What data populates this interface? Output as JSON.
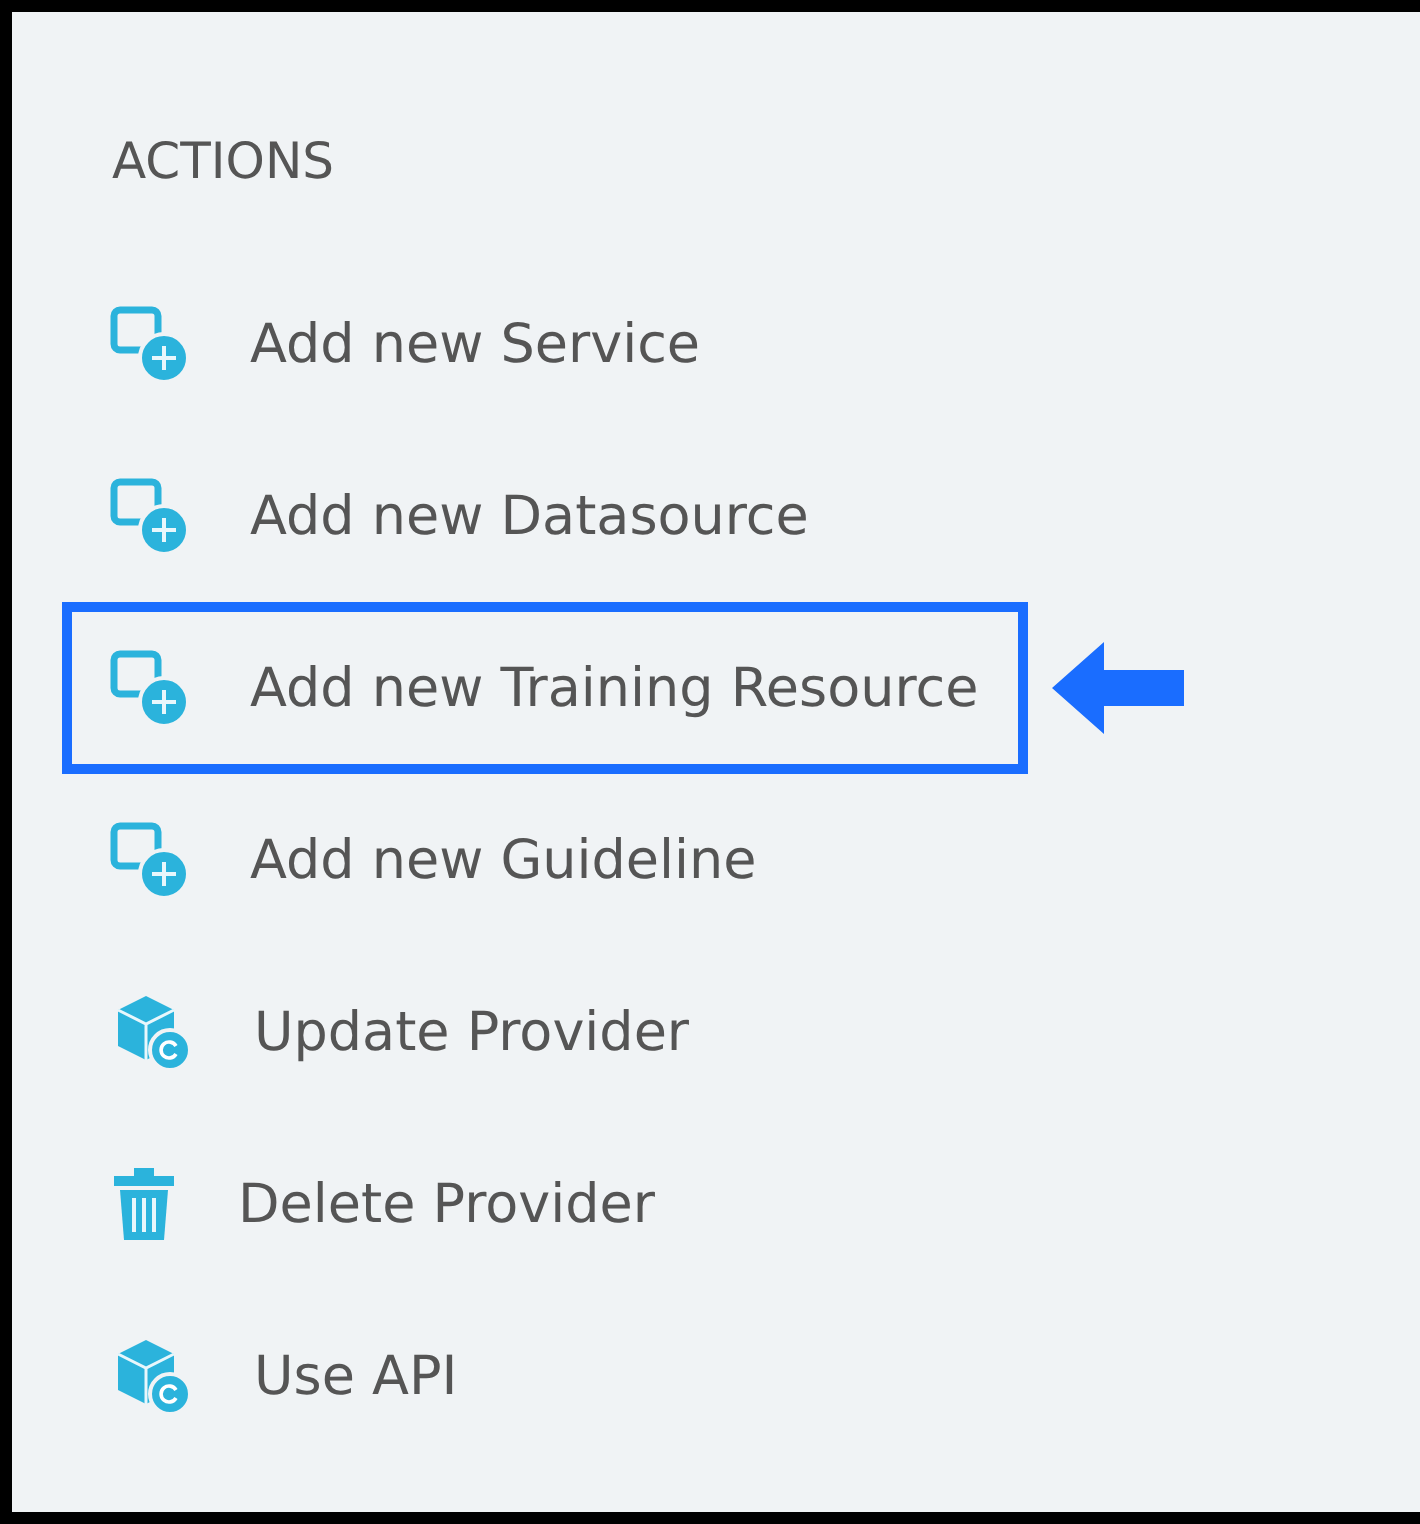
{
  "panel": {
    "heading": "ACTIONS",
    "items": [
      {
        "kind": "add",
        "label": "Add new Service",
        "highlighted": false
      },
      {
        "kind": "add",
        "label": "Add new Datasource",
        "highlighted": false
      },
      {
        "kind": "add",
        "label": "Add new Training Resource",
        "highlighted": true
      },
      {
        "kind": "add",
        "label": "Add new Guideline",
        "highlighted": false
      },
      {
        "kind": "cube",
        "label": "Update Provider",
        "highlighted": false
      },
      {
        "kind": "trash",
        "label": "Delete Provider",
        "highlighted": false
      },
      {
        "kind": "cube",
        "label": "Use API",
        "highlighted": false
      }
    ]
  }
}
